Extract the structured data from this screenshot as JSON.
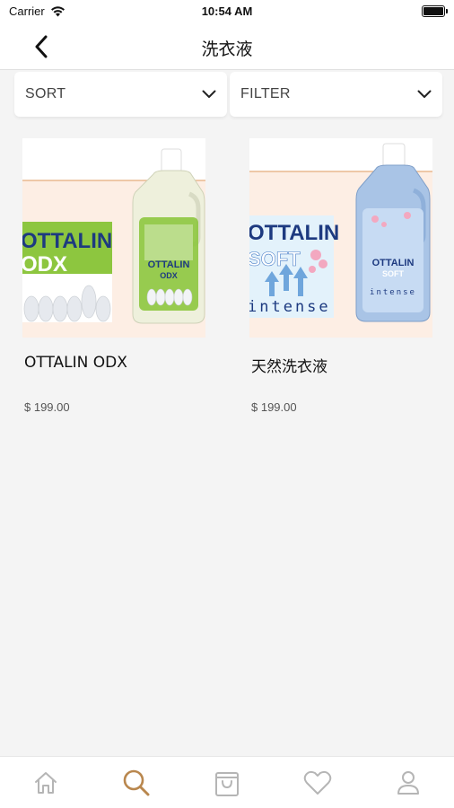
{
  "status": {
    "carrier": "Carrier",
    "time": "10:54 AM"
  },
  "nav": {
    "title": "洗衣液"
  },
  "sortbar": {
    "sort_label": "SORT",
    "filter_label": "FILTER"
  },
  "products": [
    {
      "name": "OTTALIN ODX",
      "price": "$ 199.00",
      "box_line1": "OTTALIN",
      "box_line2": "ODX",
      "bottle_brand": "OTTALIN",
      "bottle_sub": "ODX",
      "accent": "#8dc63f"
    },
    {
      "name": "天然洗衣液",
      "price": "$ 199.00",
      "box_line1": "OTTALIN",
      "box_line2": "SOFT",
      "box_line3": "intense",
      "bottle_brand": "OTTALIN",
      "bottle_sub": "SOFT",
      "bottle_line3": "intense",
      "accent": "#7fa8d8"
    }
  ],
  "tabs": [
    {
      "icon": "home-icon",
      "active": false
    },
    {
      "icon": "search-icon",
      "active": true
    },
    {
      "icon": "cart-icon",
      "active": false
    },
    {
      "icon": "heart-icon",
      "active": false
    },
    {
      "icon": "profile-icon",
      "active": false
    }
  ],
  "colors": {
    "active_tab": "#b9874e",
    "inactive_tab": "#b5b5b5",
    "background": "#f4f4f4",
    "image_peach": "#fdeee4"
  }
}
